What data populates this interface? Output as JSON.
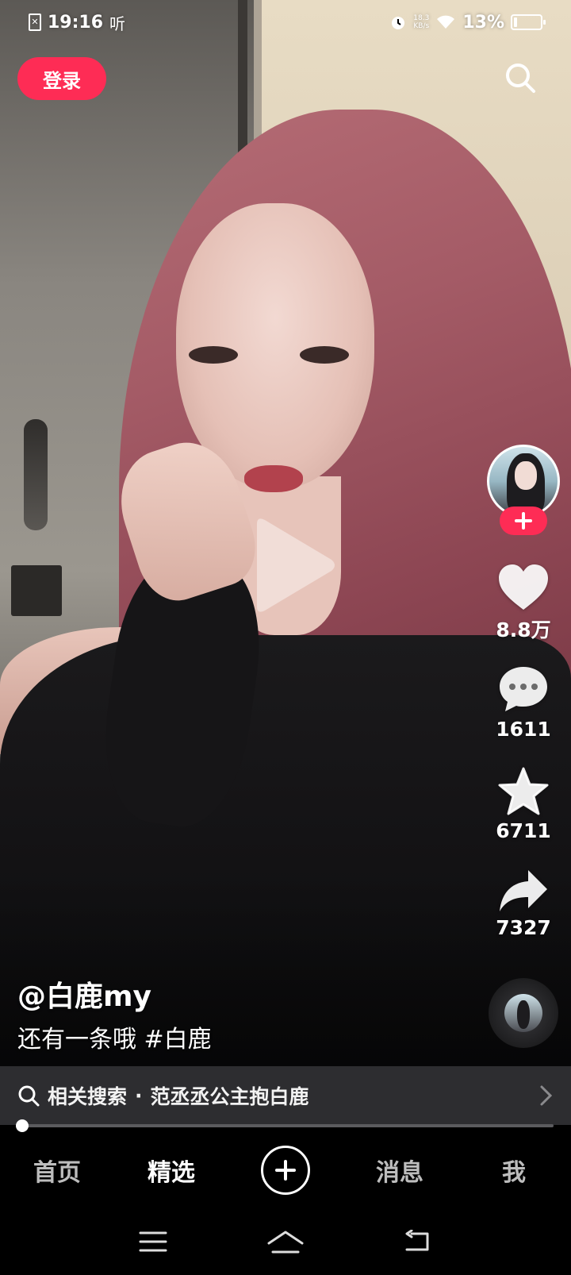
{
  "status_bar": {
    "time": "19:16",
    "listen": "听",
    "net_speed_value": "18.3",
    "net_speed_unit": "KB/s",
    "battery_percent": "13%",
    "battery_level": 0.13
  },
  "header": {
    "login_label": "登录"
  },
  "video": {
    "author": "@白鹿my",
    "caption_text": "还有一条哦",
    "caption_tag": "#白鹿"
  },
  "actions": {
    "likes": "8.8万",
    "comments": "1611",
    "favorites": "6711",
    "shares": "7327"
  },
  "related_search": {
    "label": "相关搜索",
    "separator": "·",
    "query": "范丞丞公主抱白鹿"
  },
  "progress": {
    "fraction": 0.0
  },
  "tabs": [
    {
      "label": "首页"
    },
    {
      "label": "精选"
    },
    {
      "label": "消息"
    },
    {
      "label": "我"
    }
  ],
  "icons": {
    "search": "search-icon",
    "like": "heart-icon",
    "comment": "comment-icon",
    "favorite": "star-icon",
    "share": "share-arrow-icon",
    "create": "plus-icon",
    "nav_menu": "menu-icon",
    "nav_home": "home-icon",
    "nav_back": "back-icon"
  },
  "colors": {
    "accent": "#fe2c55",
    "related_bar_bg": "#2d2d30"
  }
}
